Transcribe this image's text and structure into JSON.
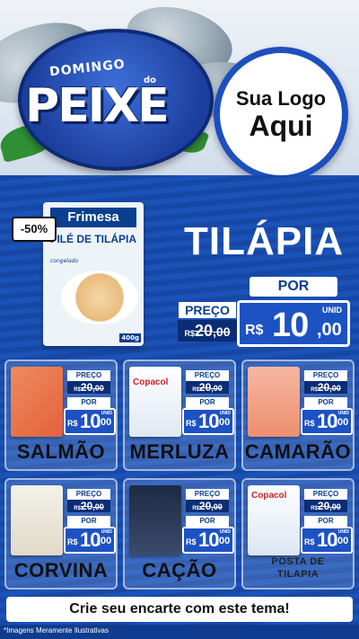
{
  "header": {
    "domingo": "DOMINGO",
    "do": "do",
    "peixe": "PEIXE",
    "logo_line1": "Sua Logo",
    "logo_line2": "Aqui"
  },
  "featured": {
    "discount": "-50%",
    "pack_brand": "Frimesa",
    "pack_title": "FILÉ DE TILÁPIA",
    "pack_sub": "congelado",
    "pack_weight": "400g",
    "name": "TILÁPIA",
    "por_label": "POR",
    "preco_label": "PREÇO",
    "old_rs": "R$",
    "old_int": "20",
    "old_cents": ",00",
    "new_rs": "R$",
    "new_int": "10",
    "new_cents": ",00",
    "unid": "UNID"
  },
  "products": [
    {
      "name": "SALMÃO",
      "preco_label": "PREÇO",
      "old_rs": "R$",
      "old_int": "20",
      "old_cents": ",00",
      "por_label": "POR",
      "new_rs": "R$",
      "new_int": "10",
      "new_cents": ",00",
      "unid": "UNID"
    },
    {
      "name": "MERLUZA",
      "brand": "Copacol",
      "preco_label": "PREÇO",
      "old_rs": "R$",
      "old_int": "20",
      "old_cents": ",00",
      "por_label": "POR",
      "new_rs": "R$",
      "new_int": "10",
      "new_cents": ",00",
      "unid": "UNID"
    },
    {
      "name": "CAMARÃO",
      "preco_label": "PREÇO",
      "old_rs": "R$",
      "old_int": "20",
      "old_cents": ",00",
      "por_label": "POR",
      "new_rs": "R$",
      "new_int": "10",
      "new_cents": ",00",
      "unid": "UNID"
    },
    {
      "name": "CORVINA",
      "preco_label": "PREÇO",
      "old_rs": "R$",
      "old_int": "20",
      "old_cents": ",00",
      "por_label": "POR",
      "new_rs": "R$",
      "new_int": "10",
      "new_cents": ",00",
      "unid": "UNID"
    },
    {
      "name": "CAÇÃO",
      "preco_label": "PREÇO",
      "old_rs": "R$",
      "old_int": "20",
      "old_cents": ",00",
      "por_label": "POR",
      "new_rs": "R$",
      "new_int": "10",
      "new_cents": ",00",
      "unid": "UNID"
    },
    {
      "name_line1": "POSTA DE",
      "name_line2": "TILAPIA",
      "brand": "Copacol",
      "preco_label": "PREÇO",
      "old_rs": "R$",
      "old_int": "20",
      "old_cents": ",00",
      "por_label": "POR",
      "new_rs": "R$",
      "new_int": "10",
      "new_cents": ",00",
      "unid": "UNID"
    }
  ],
  "cta": "Crie seu encarte com este tema!",
  "footnote": "*Imagens Meramente Ilustrativas",
  "colors": {
    "primary_blue": "#1d52c4",
    "dark_blue": "#0b2d75",
    "wave_blue": "#1848a6"
  }
}
